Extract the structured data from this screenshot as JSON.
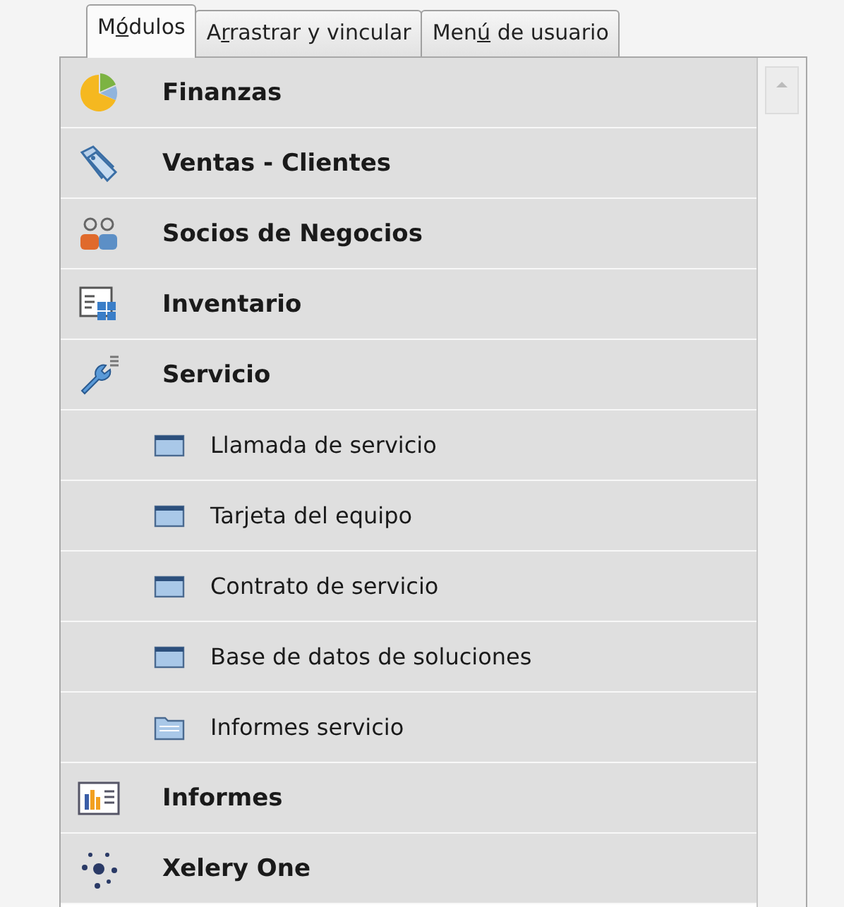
{
  "tabs": [
    {
      "label": [
        "M",
        "ó",
        "dulos"
      ],
      "selected": true
    },
    {
      "label": [
        "A",
        "r",
        "rastrar y vincular"
      ],
      "selected": false
    },
    {
      "label": [
        "Men",
        "ú",
        " de usuario"
      ],
      "selected": false
    }
  ],
  "modules": [
    {
      "label": "Finanzas",
      "kind": "finance"
    },
    {
      "label": "Ventas - Clientes",
      "kind": "sales"
    },
    {
      "label": "Socios de Negocios",
      "kind": "partners"
    },
    {
      "label": "Inventario",
      "kind": "inventory"
    },
    {
      "label": "Servicio",
      "kind": "service",
      "children": [
        {
          "label": "Llamada de servicio",
          "kind": "form"
        },
        {
          "label": "Tarjeta del equipo",
          "kind": "form"
        },
        {
          "label": "Contrato de servicio",
          "kind": "form"
        },
        {
          "label": "Base de datos de soluciones",
          "kind": "form"
        },
        {
          "label": "Informes servicio",
          "kind": "folder"
        }
      ]
    },
    {
      "label": "Informes",
      "kind": "reports"
    },
    {
      "label": "Xelery One",
      "kind": "network"
    }
  ]
}
